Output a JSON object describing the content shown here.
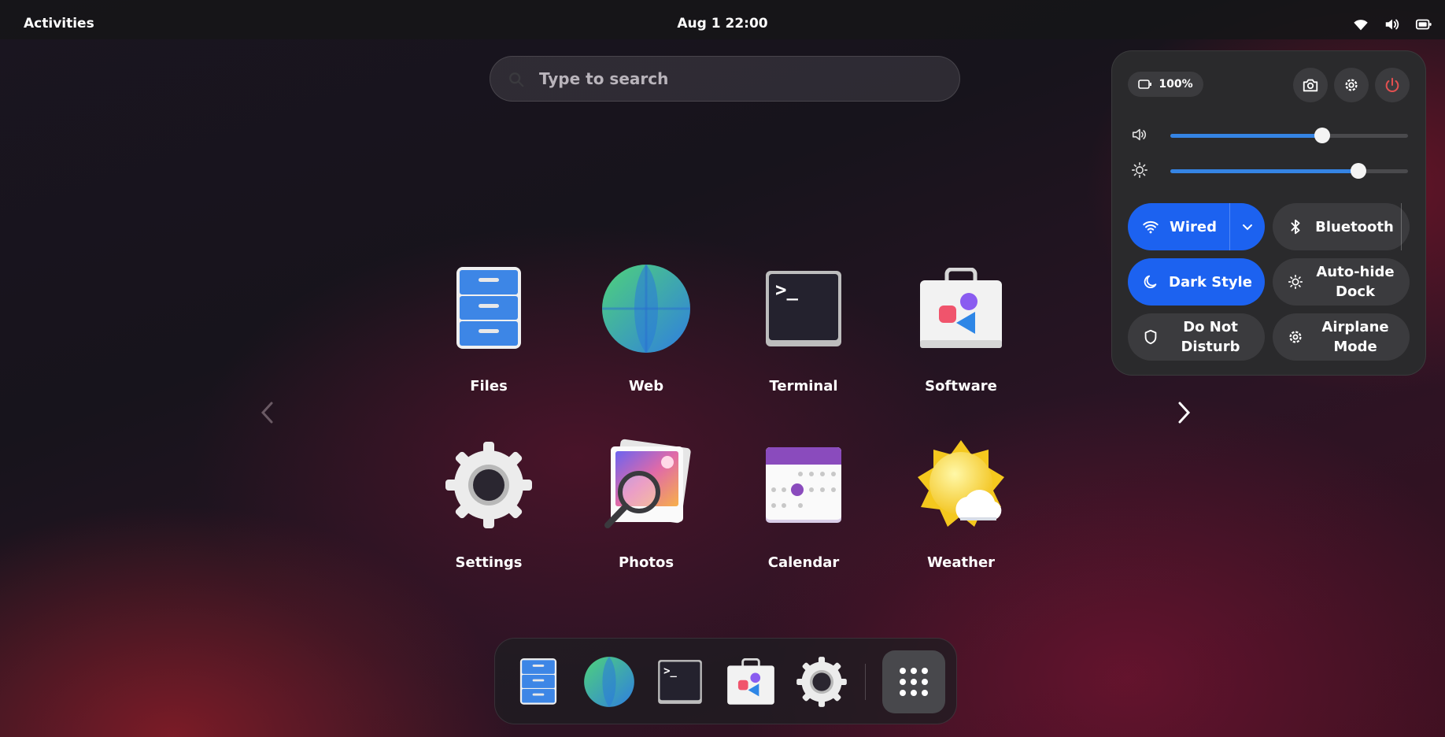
{
  "topbar": {
    "activities_label": "Activities",
    "clock": "Aug 1 22:00",
    "tray_icons": [
      "wifi-icon",
      "volume-icon",
      "battery-icon"
    ]
  },
  "search": {
    "placeholder": "Type to search"
  },
  "apps": [
    {
      "label": "Files",
      "icon": "files-icon"
    },
    {
      "label": "Web",
      "icon": "web-icon"
    },
    {
      "label": "Terminal",
      "icon": "terminal-icon"
    },
    {
      "label": "Software",
      "icon": "software-icon"
    },
    {
      "label": "Settings",
      "icon": "settings-gear-icon"
    },
    {
      "label": "Photos",
      "icon": "photos-icon"
    },
    {
      "label": "Calendar",
      "icon": "calendar-icon"
    },
    {
      "label": "Weather",
      "icon": "weather-icon"
    }
  ],
  "pager": {
    "prev_icon": "chevron-left-icon",
    "next_icon": "chevron-right-icon"
  },
  "quick_settings": {
    "battery_percent": "100%",
    "volume_level": 0.64,
    "brightness_level": 0.79,
    "buttons": [
      "screenshot-icon",
      "settings-icon",
      "power-icon"
    ],
    "tiles": [
      {
        "label": "Wired",
        "icon": "wifi-icon",
        "active": true,
        "has_menu": true
      },
      {
        "label": "Bluetooth",
        "icon": "bluetooth-icon",
        "active": false,
        "has_menu": true
      },
      {
        "label": "Dark Style",
        "icon": "moon-icon",
        "active": true
      },
      {
        "label": "Auto-hide Dock",
        "icon": "sun-icon",
        "active": false
      },
      {
        "label": "Do Not Disturb",
        "icon": "shield-icon",
        "active": false
      },
      {
        "label": "Airplane Mode",
        "icon": "gear-icon",
        "active": false
      }
    ],
    "colors": {
      "accent": "#1c62f0",
      "power": "#e35050",
      "slider": "#3584e4"
    }
  },
  "dock": {
    "items": [
      "files-icon",
      "web-icon",
      "terminal-icon",
      "software-icon",
      "settings-gear-icon"
    ],
    "show_apps_icon": "app-grid-icon"
  }
}
